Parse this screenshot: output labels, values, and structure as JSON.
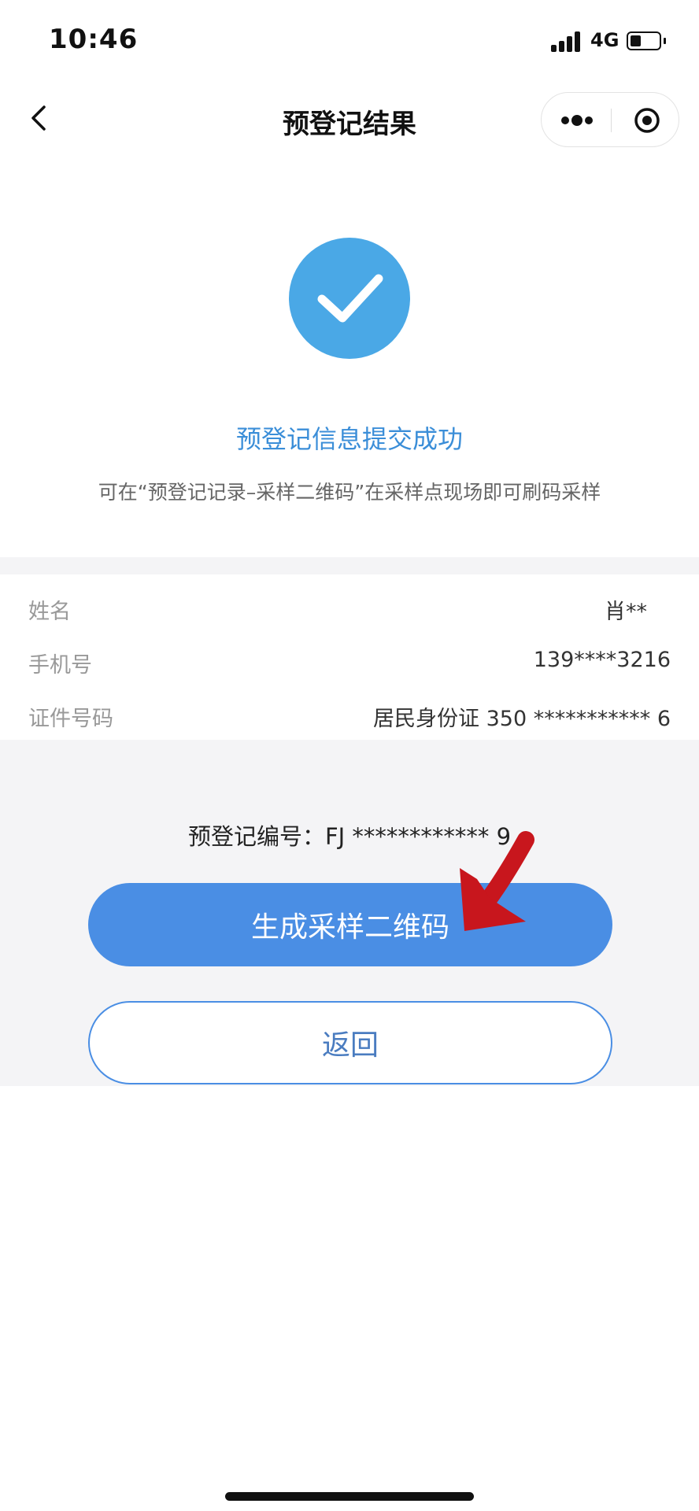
{
  "status_bar": {
    "time": "10:46",
    "network": "4G",
    "battery_level": 0.35
  },
  "nav": {
    "title": "预登记结果",
    "back_icon": "chevron-left-icon",
    "more_icon": "more-dots-icon",
    "close_icon": "target-circle-icon"
  },
  "result": {
    "icon": "check-circle-icon",
    "title": "预登记信息提交成功",
    "description": "可在“预登记记录–采样二维码”在采样点现场即可刷码采样"
  },
  "info": {
    "rows": [
      {
        "label": "姓名",
        "value": "肖**"
      },
      {
        "label": "手机号",
        "value": "139****3216"
      },
      {
        "label": "证件号码",
        "value": "居民身份证 350 *********** 6"
      }
    ]
  },
  "registration": {
    "number_text": "预登记编号：FJ ************ 9"
  },
  "actions": {
    "generate_label": "生成采样二维码",
    "back_label": "返回"
  },
  "colors": {
    "primary": "#4a8ee4",
    "success": "#4aa8e6",
    "title_blue": "#3b8ed8",
    "annotation_red": "#c8161d"
  }
}
